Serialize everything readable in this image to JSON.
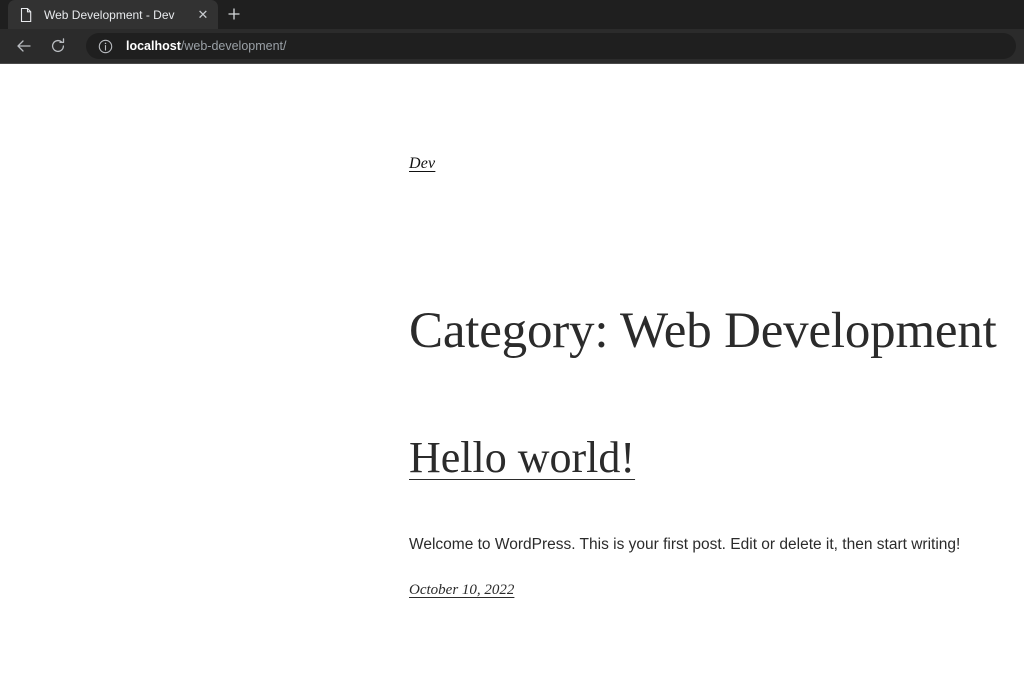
{
  "browser": {
    "tab": {
      "favicon": "page-icon",
      "title": "Web Development - Dev",
      "close_label": "✕"
    },
    "new_tab_label": "+",
    "toolbar": {
      "back_icon": "back-arrow-icon",
      "reload_icon": "reload-icon",
      "site_info_icon": "info-circle-icon",
      "url_host": "localhost",
      "url_path": "/web-development/",
      "url_full": "localhost/web-development/"
    },
    "colors": {
      "tab_strip_bg": "#1f1f1f",
      "active_tab_bg": "#323232",
      "toolbar_bg": "#2b2b2b",
      "omnibox_bg": "#1f1f1f",
      "tab_title_color": "#e8eaed",
      "url_host_color": "#ffffff",
      "url_path_color": "#9aa0a6"
    }
  },
  "page": {
    "site_title": "Dev",
    "archive_title": "Category: Web Development",
    "post": {
      "title": "Hello world!",
      "excerpt": "Welcome to WordPress. This is your first post. Edit or delete it, then start writing!",
      "date": "October 10, 2022"
    },
    "colors": {
      "background": "#ffffff",
      "text": "#2b2b2b",
      "link": "#111111"
    }
  }
}
